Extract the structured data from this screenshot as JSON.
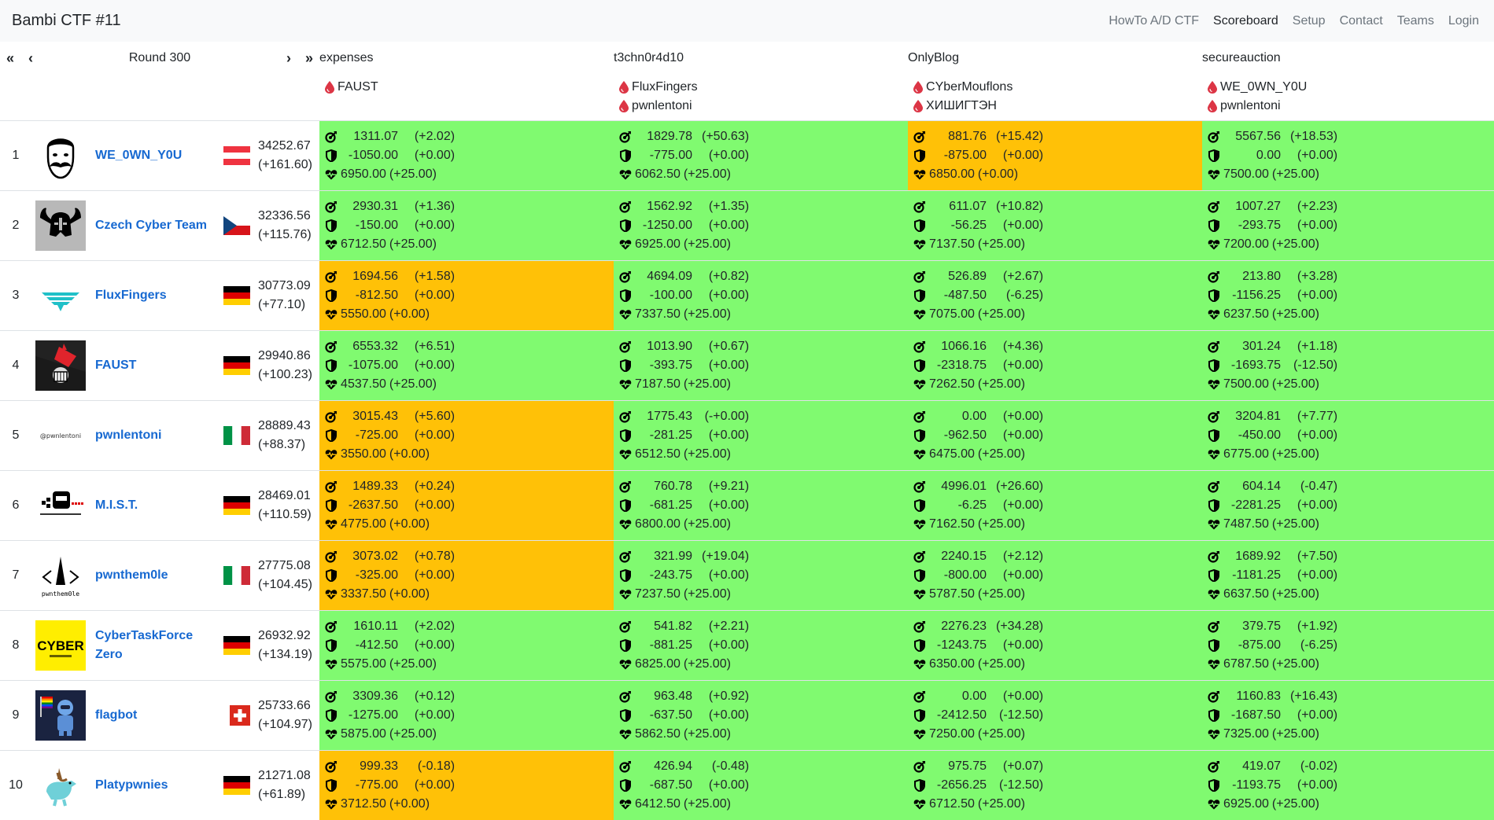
{
  "app": {
    "title": "Bambi CTF #11"
  },
  "nav": [
    {
      "label": "HowTo A/D CTF",
      "active": false
    },
    {
      "label": "Scoreboard",
      "active": true
    },
    {
      "label": "Setup",
      "active": false
    },
    {
      "label": "Contact",
      "active": false
    },
    {
      "label": "Teams",
      "active": false
    },
    {
      "label": "Login",
      "active": false
    }
  ],
  "round": {
    "label": "Round 300",
    "first": "«",
    "prev": "‹",
    "next": "›",
    "last": "»"
  },
  "services": [
    {
      "name": "expenses",
      "firstbloods": [
        "FAUST"
      ]
    },
    {
      "name": "t3chn0r4d10",
      "firstbloods": [
        "FluxFingers",
        "pwnlentoni"
      ]
    },
    {
      "name": "OnlyBlog",
      "firstbloods": [
        "CYberMouflons",
        "ХИШИГТЭН"
      ]
    },
    {
      "name": "secureauction",
      "firstbloods": [
        "WE_0WN_Y0U",
        "pwnlentoni"
      ]
    }
  ],
  "colors": {
    "ok": "#80fa70",
    "warn": "#ffc107",
    "link": "#1769d1",
    "drop": "#dc3545"
  },
  "icons": {
    "attack": "attack-icon",
    "defense": "shield-icon",
    "sla": "heart-icon",
    "firstblood": "blood-drop-icon"
  },
  "teams": [
    {
      "rank": "1",
      "name": "WE_0WN_Y0U",
      "flag": "at",
      "logo": "mustache-face",
      "score": "34252.67",
      "delta": "(+161.60)",
      "services": [
        {
          "status": "green",
          "att": "1311.07",
          "att_d": "(+2.02)",
          "def": "-1050.00",
          "def_d": "(+0.00)",
          "sla": "6950.00",
          "sla_d": "(+25.00)"
        },
        {
          "status": "green",
          "att": "1829.78",
          "att_d": "(+50.63)",
          "def": "-775.00",
          "def_d": "(+0.00)",
          "sla": "6062.50",
          "sla_d": "(+25.00)"
        },
        {
          "status": "orange",
          "att": "881.76",
          "att_d": "(+15.42)",
          "def": "-875.00",
          "def_d": "(+0.00)",
          "sla": "6850.00",
          "sla_d": "(+0.00)"
        },
        {
          "status": "green",
          "att": "5567.56",
          "att_d": "(+18.53)",
          "def": "0.00",
          "def_d": "(+0.00)",
          "sla": "7500.00",
          "sla_d": "(+25.00)"
        }
      ]
    },
    {
      "rank": "2",
      "name": "Czech Cyber Team",
      "flag": "cz",
      "logo": "viking-helmet",
      "score": "32336.56",
      "delta": "(+115.76)",
      "services": [
        {
          "status": "green",
          "att": "2930.31",
          "att_d": "(+1.36)",
          "def": "-150.00",
          "def_d": "(+0.00)",
          "sla": "6712.50",
          "sla_d": "(+25.00)"
        },
        {
          "status": "green",
          "att": "1562.92",
          "att_d": "(+1.35)",
          "def": "-1250.00",
          "def_d": "(+0.00)",
          "sla": "6925.00",
          "sla_d": "(+25.00)"
        },
        {
          "status": "green",
          "att": "611.07",
          "att_d": "(+10.82)",
          "def": "-56.25",
          "def_d": "(+0.00)",
          "sla": "7137.50",
          "sla_d": "(+25.00)"
        },
        {
          "status": "green",
          "att": "1007.27",
          "att_d": "(+2.23)",
          "def": "-293.75",
          "def_d": "(+0.00)",
          "sla": "7200.00",
          "sla_d": "(+25.00)"
        }
      ]
    },
    {
      "rank": "3",
      "name": "FluxFingers",
      "flag": "de",
      "logo": "fluxfingers",
      "score": "30773.09",
      "delta": "(+77.10)",
      "services": [
        {
          "status": "orange",
          "att": "1694.56",
          "att_d": "(+1.58)",
          "def": "-812.50",
          "def_d": "(+0.00)",
          "sla": "5550.00",
          "sla_d": "(+0.00)"
        },
        {
          "status": "green",
          "att": "4694.09",
          "att_d": "(+0.82)",
          "def": "-100.00",
          "def_d": "(+0.00)",
          "sla": "7337.50",
          "sla_d": "(+25.00)"
        },
        {
          "status": "green",
          "att": "526.89",
          "att_d": "(+2.67)",
          "def": "-487.50",
          "def_d": "(-6.25)",
          "sla": "7075.00",
          "sla_d": "(+25.00)"
        },
        {
          "status": "green",
          "att": "213.80",
          "att_d": "(+3.28)",
          "def": "-1156.25",
          "def_d": "(+0.00)",
          "sla": "6237.50",
          "sla_d": "(+25.00)"
        }
      ]
    },
    {
      "rank": "4",
      "name": "FAUST",
      "flag": "de",
      "logo": "faust-fist",
      "score": "29940.86",
      "delta": "(+100.23)",
      "services": [
        {
          "status": "green",
          "att": "6553.32",
          "att_d": "(+6.51)",
          "def": "-1075.00",
          "def_d": "(+0.00)",
          "sla": "4537.50",
          "sla_d": "(+25.00)"
        },
        {
          "status": "green",
          "att": "1013.90",
          "att_d": "(+0.67)",
          "def": "-393.75",
          "def_d": "(+0.00)",
          "sla": "7187.50",
          "sla_d": "(+25.00)"
        },
        {
          "status": "green",
          "att": "1066.16",
          "att_d": "(+4.36)",
          "def": "-2318.75",
          "def_d": "(+0.00)",
          "sla": "7262.50",
          "sla_d": "(+25.00)"
        },
        {
          "status": "green",
          "att": "301.24",
          "att_d": "(+1.18)",
          "def": "-1693.75",
          "def_d": "(-12.50)",
          "sla": "7500.00",
          "sla_d": "(+25.00)"
        }
      ]
    },
    {
      "rank": "5",
      "name": "pwnlentoni",
      "flag": "it",
      "logo": "pwnlentoni-text",
      "logo_text": "@pwnlentoni",
      "score": "28889.43",
      "delta": "(+88.37)",
      "services": [
        {
          "status": "orange",
          "att": "3015.43",
          "att_d": "(+5.60)",
          "def": "-725.00",
          "def_d": "(+0.00)",
          "sla": "3550.00",
          "sla_d": "(+0.00)"
        },
        {
          "status": "green",
          "att": "1775.43",
          "att_d": "(-+0.00)",
          "def": "-281.25",
          "def_d": "(+0.00)",
          "sla": "6512.50",
          "sla_d": "(+25.00)"
        },
        {
          "status": "green",
          "att": "0.00",
          "att_d": "(+0.00)",
          "def": "-962.50",
          "def_d": "(+0.00)",
          "sla": "6475.00",
          "sla_d": "(+25.00)"
        },
        {
          "status": "green",
          "att": "3204.81",
          "att_d": "(+7.77)",
          "def": "-450.00",
          "def_d": "(+0.00)",
          "sla": "6775.00",
          "sla_d": "(+25.00)"
        }
      ]
    },
    {
      "rank": "6",
      "name": "M.I.S.T.",
      "flag": "de",
      "logo": "mist-robot",
      "score": "28469.01",
      "delta": "(+110.59)",
      "services": [
        {
          "status": "orange",
          "att": "1489.33",
          "att_d": "(+0.24)",
          "def": "-2637.50",
          "def_d": "(+0.00)",
          "sla": "4775.00",
          "sla_d": "(+0.00)"
        },
        {
          "status": "green",
          "att": "760.78",
          "att_d": "(+9.21)",
          "def": "-681.25",
          "def_d": "(+0.00)",
          "sla": "6800.00",
          "sla_d": "(+25.00)"
        },
        {
          "status": "green",
          "att": "4996.01",
          "att_d": "(+26.60)",
          "def": "-6.25",
          "def_d": "(+0.00)",
          "sla": "7162.50",
          "sla_d": "(+25.00)"
        },
        {
          "status": "green",
          "att": "604.14",
          "att_d": "(-0.47)",
          "def": "-2281.25",
          "def_d": "(+0.00)",
          "sla": "7487.50",
          "sla_d": "(+25.00)"
        }
      ]
    },
    {
      "rank": "7",
      "name": "pwnthem0le",
      "flag": "it",
      "logo": "pwnthem0le-mole",
      "logo_text": "pwnthem0le",
      "score": "27775.08",
      "delta": "(+104.45)",
      "services": [
        {
          "status": "orange",
          "att": "3073.02",
          "att_d": "(+0.78)",
          "def": "-325.00",
          "def_d": "(+0.00)",
          "sla": "3337.50",
          "sla_d": "(+0.00)"
        },
        {
          "status": "green",
          "att": "321.99",
          "att_d": "(+19.04)",
          "def": "-243.75",
          "def_d": "(+0.00)",
          "sla": "7237.50",
          "sla_d": "(+25.00)"
        },
        {
          "status": "green",
          "att": "2240.15",
          "att_d": "(+2.12)",
          "def": "-800.00",
          "def_d": "(+0.00)",
          "sla": "5787.50",
          "sla_d": "(+25.00)"
        },
        {
          "status": "green",
          "att": "1689.92",
          "att_d": "(+7.50)",
          "def": "-1181.25",
          "def_d": "(+0.00)",
          "sla": "6637.50",
          "sla_d": "(+25.00)"
        }
      ]
    },
    {
      "rank": "8",
      "name": "CyberTaskForce Zero",
      "flag": "de",
      "logo": "cyber-yellow",
      "logo_text": "CYBER",
      "score": "26932.92",
      "delta": "(+134.19)",
      "services": [
        {
          "status": "green",
          "att": "1610.11",
          "att_d": "(+2.02)",
          "def": "-412.50",
          "def_d": "(+0.00)",
          "sla": "5575.00",
          "sla_d": "(+25.00)"
        },
        {
          "status": "green",
          "att": "541.82",
          "att_d": "(+2.21)",
          "def": "-881.25",
          "def_d": "(+0.00)",
          "sla": "6825.00",
          "sla_d": "(+25.00)"
        },
        {
          "status": "green",
          "att": "2276.23",
          "att_d": "(+34.28)",
          "def": "-1243.75",
          "def_d": "(+0.00)",
          "sla": "6350.00",
          "sla_d": "(+25.00)"
        },
        {
          "status": "green",
          "att": "379.75",
          "att_d": "(+1.92)",
          "def": "-875.00",
          "def_d": "(-6.25)",
          "sla": "6787.50",
          "sla_d": "(+25.00)"
        }
      ]
    },
    {
      "rank": "9",
      "name": "flagbot",
      "flag": "ch",
      "logo": "flagbot-robot",
      "score": "25733.66",
      "delta": "(+104.97)",
      "services": [
        {
          "status": "green",
          "att": "3309.36",
          "att_d": "(+0.12)",
          "def": "-1275.00",
          "def_d": "(+0.00)",
          "sla": "5875.00",
          "sla_d": "(+25.00)"
        },
        {
          "status": "green",
          "att": "963.48",
          "att_d": "(+0.92)",
          "def": "-637.50",
          "def_d": "(+0.00)",
          "sla": "5862.50",
          "sla_d": "(+25.00)"
        },
        {
          "status": "green",
          "att": "0.00",
          "att_d": "(+0.00)",
          "def": "-2412.50",
          "def_d": "(-12.50)",
          "sla": "7250.00",
          "sla_d": "(+25.00)"
        },
        {
          "status": "green",
          "att": "1160.83",
          "att_d": "(+16.43)",
          "def": "-1687.50",
          "def_d": "(+0.00)",
          "sla": "7325.00",
          "sla_d": "(+25.00)"
        }
      ]
    },
    {
      "rank": "10",
      "name": "Platypwnies",
      "flag": "de",
      "logo": "platypus-unicorn",
      "score": "21271.08",
      "delta": "(+61.89)",
      "services": [
        {
          "status": "orange",
          "att": "999.33",
          "att_d": "(-0.18)",
          "def": "-775.00",
          "def_d": "(+0.00)",
          "sla": "3712.50",
          "sla_d": "(+0.00)"
        },
        {
          "status": "green",
          "att": "426.94",
          "att_d": "(-0.48)",
          "def": "-687.50",
          "def_d": "(+0.00)",
          "sla": "6412.50",
          "sla_d": "(+25.00)"
        },
        {
          "status": "green",
          "att": "975.75",
          "att_d": "(+0.07)",
          "def": "-2656.25",
          "def_d": "(-12.50)",
          "sla": "6712.50",
          "sla_d": "(+25.00)"
        },
        {
          "status": "green",
          "att": "419.07",
          "att_d": "(-0.02)",
          "def": "-1193.75",
          "def_d": "(+0.00)",
          "sla": "6925.00",
          "sla_d": "(+25.00)"
        }
      ]
    }
  ]
}
